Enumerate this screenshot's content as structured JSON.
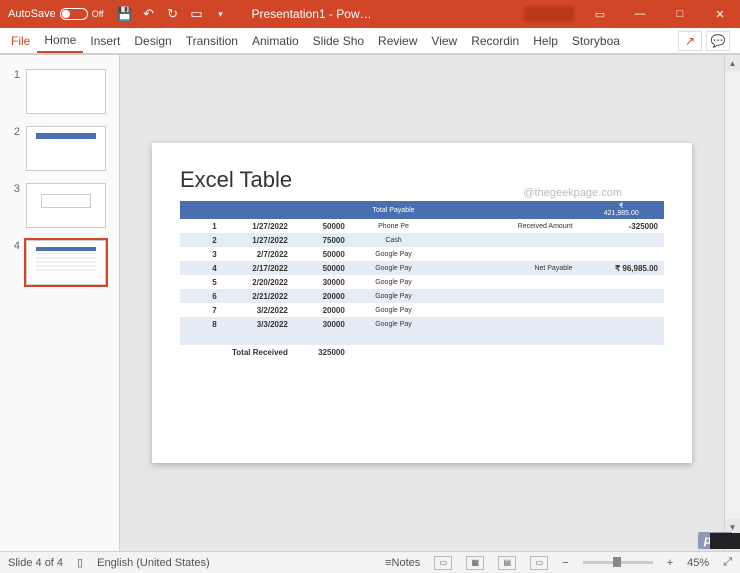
{
  "titlebar": {
    "autosave_label": "AutoSave",
    "autosave_state": "Off",
    "doc_title": "Presentation1 - Pow…"
  },
  "ribbon": {
    "tabs": [
      "File",
      "Home",
      "Insert",
      "Design",
      "Transition",
      "Animatio",
      "Slide Sho",
      "Review",
      "View",
      "Recordin",
      "Help",
      "Storyboa"
    ],
    "active_index": 1,
    "share_icon": "↗",
    "comment_icon": "💬"
  },
  "thumbnails": {
    "count": 4,
    "selected": 4
  },
  "slide": {
    "title": "Excel Table",
    "watermark": "@thegeekpage.com",
    "header_mid": "Total Payable",
    "header_right_top": "₹",
    "header_right_val": "421,985.00",
    "rows": [
      {
        "i": "1",
        "d": "1/27/2022",
        "a": "50000",
        "p": "Phone Pe",
        "rl": "Received Amount",
        "rv": "-325000"
      },
      {
        "i": "2",
        "d": "1/27/2022",
        "a": "75000",
        "p": "Cash",
        "rl": "",
        "rv": ""
      },
      {
        "i": "3",
        "d": "2/7/2022",
        "a": "50000",
        "p": "Google Pay",
        "rl": "",
        "rv": ""
      },
      {
        "i": "4",
        "d": "2/17/2022",
        "a": "50000",
        "p": "Google Pay",
        "rl": "Net Payable",
        "rv": "₹ 96,985.00"
      },
      {
        "i": "5",
        "d": "2/20/2022",
        "a": "30000",
        "p": "Google Pay",
        "rl": "",
        "rv": ""
      },
      {
        "i": "6",
        "d": "2/21/2022",
        "a": "20000",
        "p": "Google Pay",
        "rl": "",
        "rv": ""
      },
      {
        "i": "7",
        "d": "3/2/2022",
        "a": "20000",
        "p": "Google Pay",
        "rl": "",
        "rv": ""
      },
      {
        "i": "8",
        "d": "3/3/2022",
        "a": "30000",
        "p": "Google Pay",
        "rl": "",
        "rv": ""
      }
    ],
    "total_label": "Total Received",
    "total_value": "325000"
  },
  "statusbar": {
    "slide_info": "Slide 4 of 4",
    "language": "English (United States)",
    "notes_label": "Notes",
    "zoom_pct": "45%"
  },
  "badge": "php"
}
